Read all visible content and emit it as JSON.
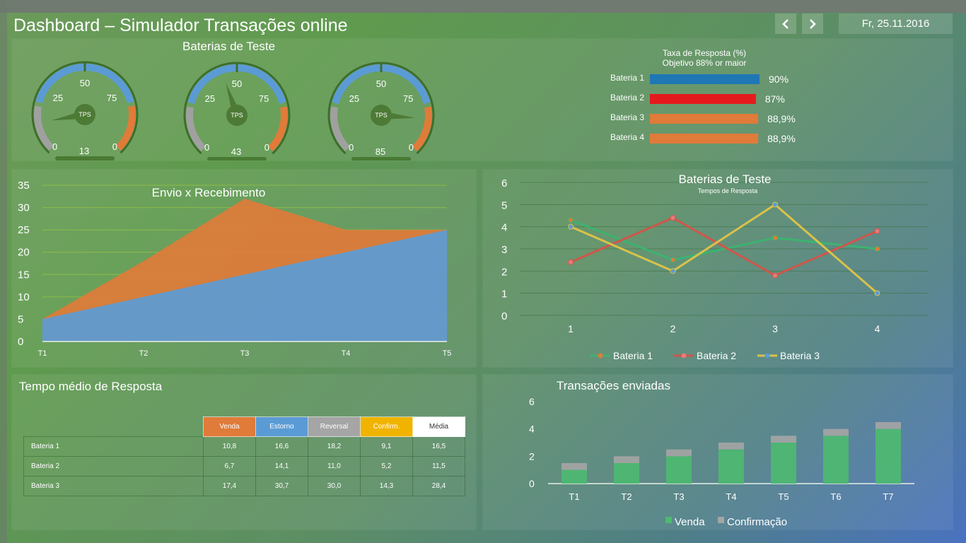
{
  "header": {
    "title": "Dashboard – Simulador Transações online",
    "date": "Fr, 25.11.2016",
    "prev_icon": "chevron-left-icon",
    "next_icon": "chevron-right-icon"
  },
  "gauges_panel": {
    "title": "Baterias de Teste",
    "gauges": [
      {
        "value": 13,
        "unit": "TPS",
        "ticks": [
          "0",
          "25",
          "50",
          "75",
          "0"
        ]
      },
      {
        "value": 43,
        "unit": "TPS",
        "ticks": [
          "0",
          "25",
          "50",
          "75",
          "0"
        ]
      },
      {
        "value": 85,
        "unit": "TPS",
        "ticks": [
          "0",
          "25",
          "50",
          "75",
          "0"
        ]
      }
    ],
    "colors": {
      "low": "#a0a0a0",
      "mid": "#5b9bd5",
      "high": "#e07b39",
      "needle": "#4d7a35"
    }
  },
  "response_rate": {
    "title": "Taxa de Resposta (%)",
    "subtitle": "Objetivo 88% or maior",
    "rows": [
      {
        "label": "Bateria 1",
        "value_text": "90%",
        "value": 90,
        "color": "#1f77b4"
      },
      {
        "label": "Bateria 2",
        "value_text": "87%",
        "value": 87,
        "color": "#e41a1c"
      },
      {
        "label": "Bateria 3",
        "value_text": "88,9%",
        "value": 88.9,
        "color": "#e07b39"
      },
      {
        "label": "Bateria 4",
        "value_text": "88,9%",
        "value": 88.9,
        "color": "#e07b39"
      }
    ]
  },
  "area_chart": {
    "title": "Envio x Recebimento",
    "chart_data": {
      "type": "area",
      "title": "Envio x Recebimento",
      "categories": [
        "T1",
        "T2",
        "T3",
        "T4",
        "T5"
      ],
      "ylim": [
        0,
        35
      ],
      "yticks": [
        "0",
        "5",
        "10",
        "15",
        "20",
        "25",
        "30",
        "35"
      ],
      "series": [
        {
          "values": [
            5,
            18,
            32,
            25,
            25
          ],
          "color": "#e07b39"
        },
        {
          "values": [
            5,
            10,
            15,
            20,
            25
          ],
          "color": "#5b9bd5"
        }
      ]
    }
  },
  "line_chart": {
    "title": "Baterias de Teste",
    "subtitle": "Tempos de Resposta",
    "chart_data": {
      "type": "line",
      "title": "Baterias de Teste",
      "subtitle": "Tempos de Resposta",
      "categories": [
        "1",
        "2",
        "3",
        "4"
      ],
      "ylim": [
        0,
        6
      ],
      "yticks": [
        "0",
        "1",
        "2",
        "3",
        "4",
        "5",
        "6"
      ],
      "series": [
        {
          "name": "Bateria 1",
          "values": [
            4.3,
            2.5,
            3.5,
            3.0
          ],
          "color": "#3cb371",
          "marker": "#e07b39"
        },
        {
          "name": "Bateria 2",
          "values": [
            2.4,
            4.4,
            1.8,
            3.8
          ],
          "color": "#d0564a",
          "marker": "#e87a7a"
        },
        {
          "name": "Bateria 3",
          "values": [
            4.0,
            2.0,
            5.0,
            1.0
          ],
          "color": "#d9c24a",
          "marker": "#5b9bd5"
        }
      ],
      "legend": "bottom"
    }
  },
  "table_panel": {
    "title": "Tempo médio de Resposta",
    "headers": [
      "Venda",
      "Estorno",
      "Reversal",
      "Confirm.",
      "Média"
    ],
    "header_colors": [
      "#e07b39",
      "#5b9bd5",
      "#a5a5a5",
      "#f0b400",
      "#ffffff"
    ],
    "rows": [
      {
        "label": "Bateria 1",
        "cells": [
          "10,8",
          "16,6",
          "18,2",
          "9,1",
          "16,5"
        ]
      },
      {
        "label": "Bateria 2",
        "cells": [
          "6,7",
          "14,1",
          "11,0",
          "5,2",
          "11,5"
        ]
      },
      {
        "label": "Bateria 3",
        "cells": [
          "17,4",
          "30,7",
          "30,0",
          "14,3",
          "28,4"
        ]
      }
    ]
  },
  "bar_chart": {
    "title": "Transações enviadas",
    "chart_data": {
      "type": "bar",
      "title": "Transações enviadas",
      "categories": [
        "T1",
        "T2",
        "T3",
        "T4",
        "T5",
        "T6",
        "T7"
      ],
      "ylim": [
        0,
        6
      ],
      "yticks": [
        "0",
        "2",
        "4",
        "6"
      ],
      "series": [
        {
          "name": "Venda",
          "values": [
            1,
            1.5,
            2,
            2.5,
            3,
            3.5,
            4
          ],
          "color": "#4cba70"
        },
        {
          "name": "Confirmação",
          "values": [
            0.5,
            0.5,
            0.5,
            0.5,
            0.5,
            0.5,
            0.5
          ],
          "color": "#a5a5a5"
        }
      ],
      "legend": "bottom"
    }
  }
}
